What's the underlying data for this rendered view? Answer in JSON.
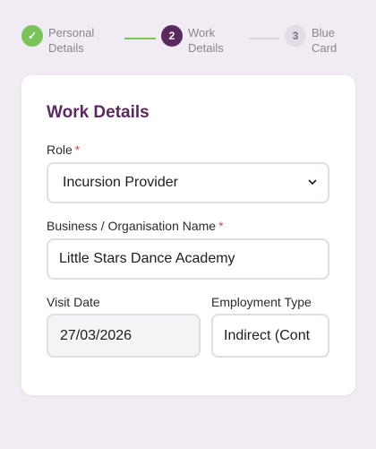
{
  "stepper": {
    "steps": [
      {
        "number": "✓",
        "label_line1": "Personal",
        "label_line2": "Details",
        "state": "done"
      },
      {
        "number": "2",
        "label_line1": "Work",
        "label_line2": "Details",
        "state": "active"
      },
      {
        "number": "3",
        "label_line1": "Blue",
        "label_line2": "Card",
        "state": "pending"
      }
    ]
  },
  "form": {
    "title": "Work Details",
    "role": {
      "label": "Role",
      "required_mark": "*",
      "value": "Incursion Provider",
      "icon": "chevron-down-icon"
    },
    "business_name": {
      "label": "Business / Organisation Name",
      "required_mark": "*",
      "value": "Little Stars Dance Academy"
    },
    "visit_date": {
      "label": "Visit Date",
      "value": "27/03/2026"
    },
    "employment_type": {
      "label": "Employment Type",
      "value": "Indirect (Cont"
    }
  },
  "colors": {
    "accent": "#5a2a5e",
    "done": "#7cc25a",
    "required": "#e04a4a",
    "background": "#f1ecf3"
  }
}
